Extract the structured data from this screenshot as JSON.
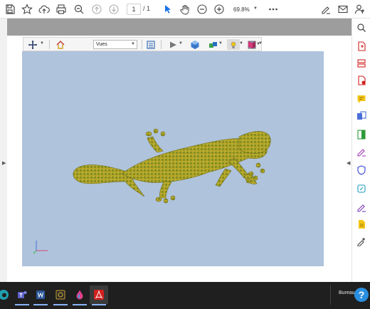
{
  "toolbar": {
    "page_current": "1",
    "page_separator": "/",
    "page_total": "1",
    "zoom_value": "69.8%"
  },
  "toolbar_3d": {
    "views_label": "Vues"
  },
  "taskbar": {
    "bureau_label": "Bureau"
  },
  "colors": {
    "viewport_background": "#afc3dc",
    "gecko": "#b5a62a",
    "accent": "#1a73e8",
    "acrobat_red": "#d3211f"
  }
}
